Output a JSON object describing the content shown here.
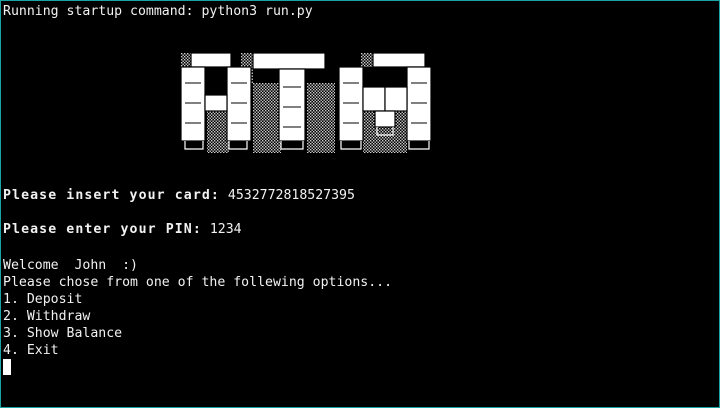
{
  "terminal": {
    "startup_line": "Running startup command: python3 run.py",
    "card_prompt": "Please insert your card:",
    "card_number": "4532772818527395",
    "pin_prompt": "Please enter your PIN:",
    "pin_value": "1234",
    "welcome_line": "Welcome  John  :)",
    "options_prompt": "Please chose from one of the follewing options...",
    "options": [
      "1. Deposit",
      "2. Withdraw",
      "3. Show Balance",
      "4. Exit"
    ]
  },
  "logo": {
    "text": "ATM"
  },
  "colors": {
    "background": "#000000",
    "text": "#f2f2f2",
    "accent_border": "#1aa3a3"
  }
}
